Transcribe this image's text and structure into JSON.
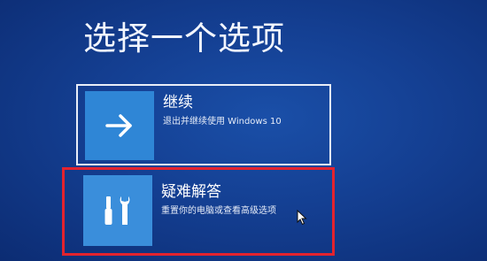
{
  "page": {
    "title": "选择一个选项"
  },
  "options": [
    {
      "label": "继续",
      "description": "退出并继续使用 Windows 10",
      "icon": "arrow-right-icon"
    },
    {
      "label": "疑难解答",
      "description": "重置你的电脑或查看高级选项",
      "icon": "tools-icon"
    }
  ],
  "colors": {
    "background": "#143f92",
    "tile": "#2f86d6",
    "highlight": "#e3232e"
  }
}
